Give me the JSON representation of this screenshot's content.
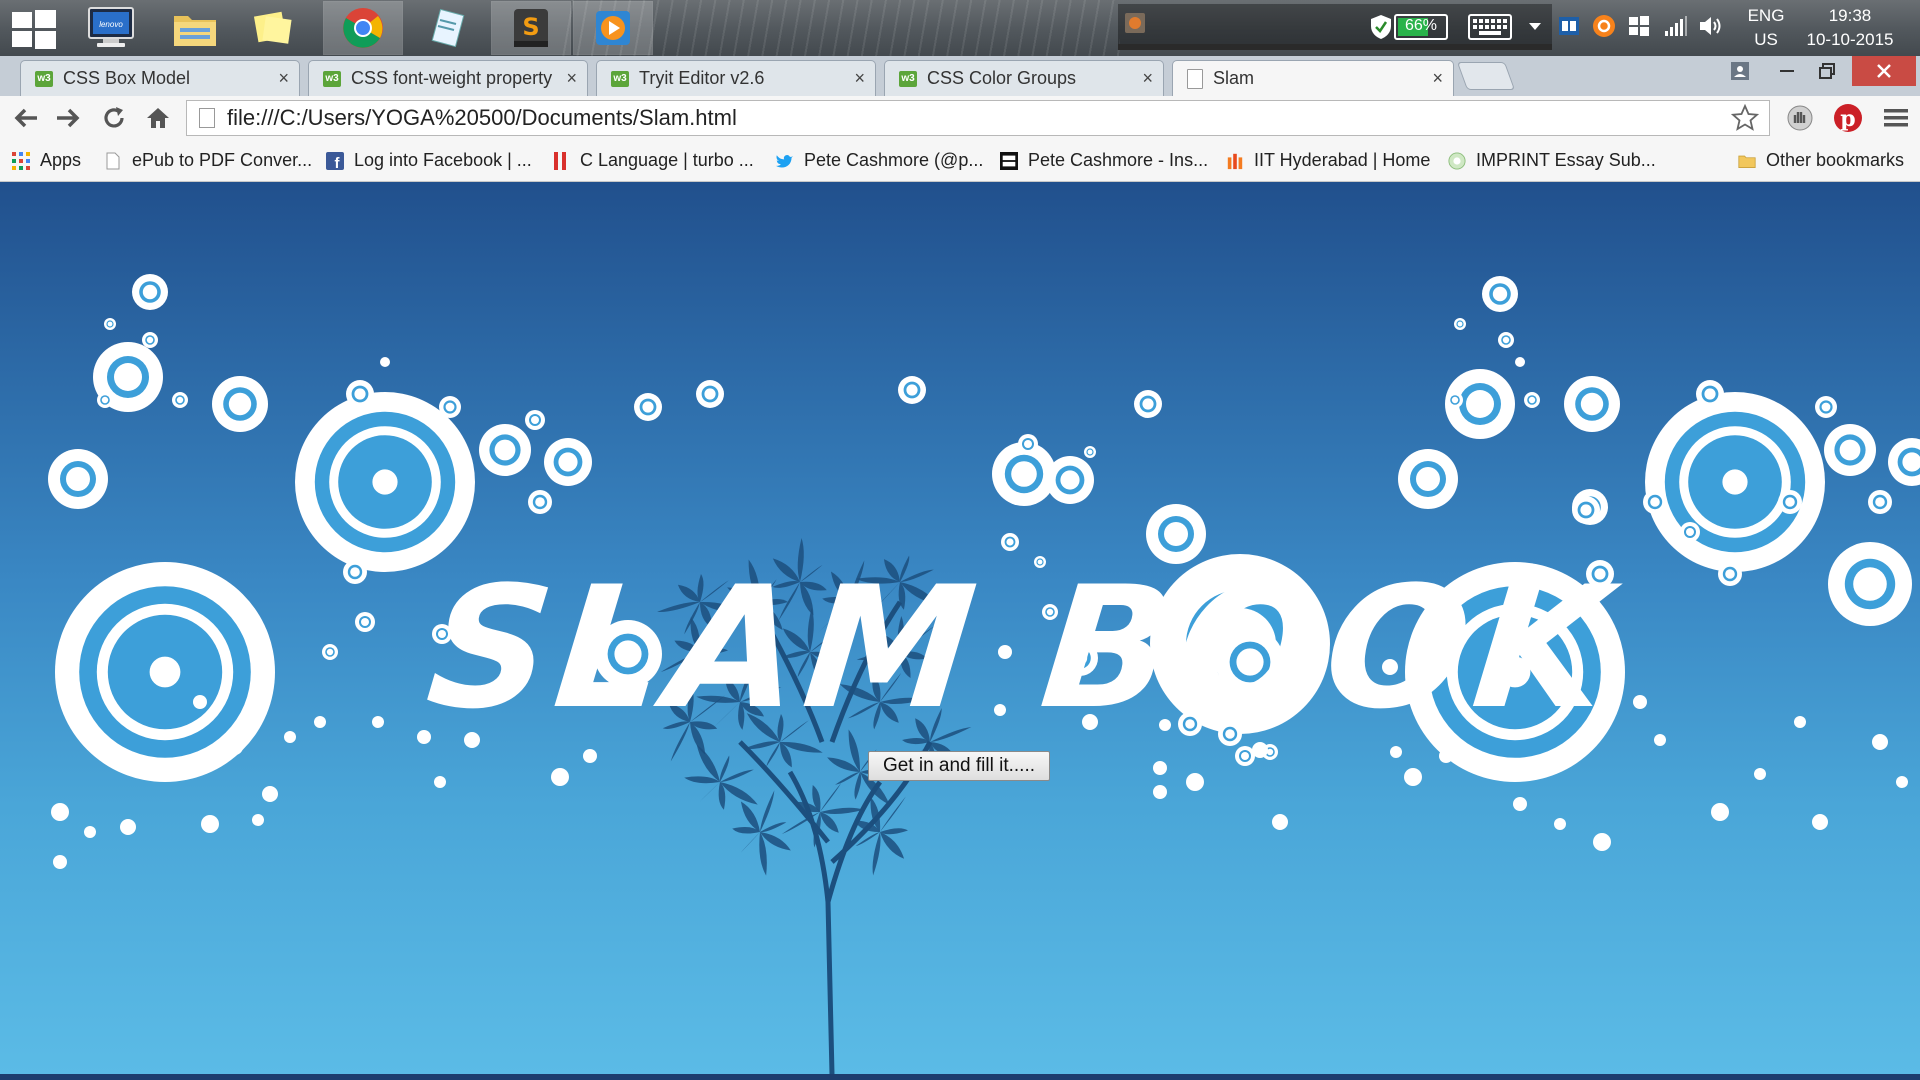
{
  "taskbar": {
    "language_line1": "ENG",
    "language_line2": "US",
    "time": "19:38",
    "date": "10-10-2015",
    "battery_percent": "66%",
    "battery_level": 0.66,
    "icons": [
      "windows-start-icon",
      "lenovo-computer-icon",
      "file-explorer-icon",
      "sticky-notes-icon",
      "chrome-icon",
      "notepad-icon",
      "sublime-text-icon",
      "media-player-icon"
    ]
  },
  "tabs": [
    {
      "label": "CSS Box Model",
      "favicon": "w3-icon",
      "active": false
    },
    {
      "label": "CSS font-weight property",
      "favicon": "w3-icon",
      "active": false
    },
    {
      "label": "Tryit Editor v2.6",
      "favicon": "w3-icon",
      "active": false
    },
    {
      "label": "CSS Color Groups",
      "favicon": "w3-icon",
      "active": false
    },
    {
      "label": "Slam",
      "favicon": "document-icon",
      "active": true
    }
  ],
  "tab_close_glyph": "×",
  "favicon_text": "w3",
  "address_bar": {
    "url": "file:///C:/Users/YOGA%20500/Documents/Slam.html"
  },
  "bookmarks": [
    {
      "label": "Apps",
      "icon": "apps-grid-icon"
    },
    {
      "label": "ePub to PDF Conver...",
      "icon": "document-icon"
    },
    {
      "label": "Log into Facebook | ...",
      "icon": "facebook-icon"
    },
    {
      "label": "C Language | turbo ...",
      "icon": "red-bars-icon"
    },
    {
      "label": "Pete Cashmore (@p...",
      "icon": "twitter-icon"
    },
    {
      "label": "Pete Cashmore - Ins...",
      "icon": "ink361-icon"
    },
    {
      "label": "IIT Hyderabad | Home",
      "icon": "iit-icon"
    },
    {
      "label": "IMPRINT Essay Sub...",
      "icon": "imprint-icon"
    }
  ],
  "other_bookmarks": "Other bookmarks",
  "page": {
    "title": "SLAM BOOK",
    "button_label": "Get in and fill it....."
  },
  "colors": {
    "bg_top": "#21508d",
    "bg_bottom": "#5bbbe6",
    "ring": "#3d9fd9",
    "tree": "#1c4f7e"
  }
}
